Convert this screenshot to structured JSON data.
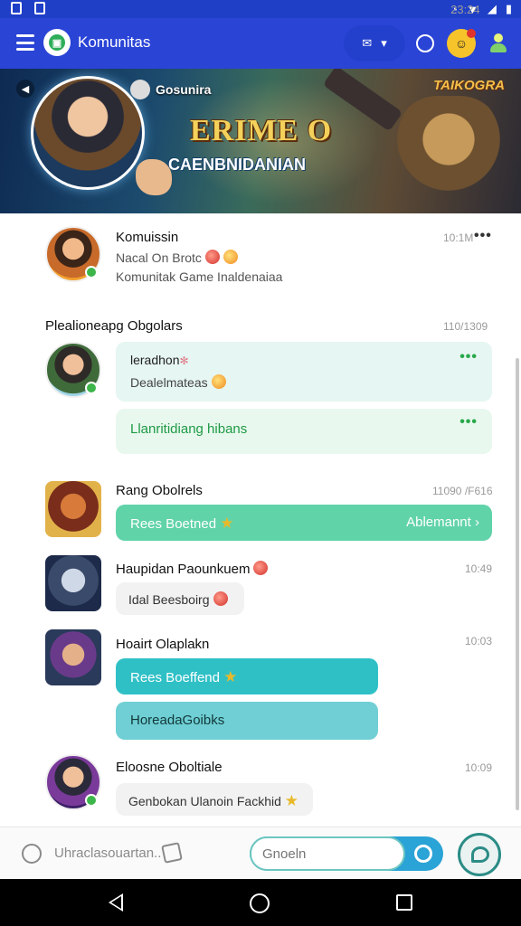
{
  "status_bar": {
    "time": "23:24"
  },
  "app_bar": {
    "title": "Komunitas",
    "mail_caret": "▾"
  },
  "banner": {
    "guild_name": "Gosunira",
    "title": "ERIME O",
    "subtitle": "CAENBNIDANIAN",
    "logo": "TAIKOGRA"
  },
  "header_post": {
    "name": "Komuissin",
    "subtitle": "Nacal On Brotc",
    "description": "Komunitak Game Inaldenaiaa",
    "time": "10:1M",
    "more": "•••"
  },
  "section": {
    "title": "Plealioneapg Obgolars",
    "time": "110/1309"
  },
  "messages": [
    {
      "bubble1_title": "leradhon",
      "bubble1_text": "Dealelmateas",
      "bubble1_more": "•••",
      "bubble2_text": "Llanritidiang hibans",
      "bubble2_more": "•••"
    },
    {
      "name": "Rang Obolrels",
      "time": "11090 /F616",
      "bubble_text": "Rees Boetned",
      "bubble_action": "Ablemannt"
    },
    {
      "name": "Haupidan Paounkuem",
      "time": "10:49",
      "bubble_text": "Idal Beesboirg"
    },
    {
      "name": "Hoairt Olaplakn",
      "time": "10:03",
      "bubble1_text": "Rees Boeffend",
      "bubble2_text": "HoreadaGoibks"
    },
    {
      "name": "Eloosne Oboltiale",
      "time": "10:09",
      "bubble_text": "Genbokan Ulanoin Fackhid"
    }
  ],
  "input_bar": {
    "placeholder": "Uhraclasouartan..",
    "search_placeholder": "Gnoeln"
  },
  "colors": {
    "primary": "#2a44d6",
    "accent_green": "#61d3a9",
    "accent_teal": "#2fc0c6"
  }
}
